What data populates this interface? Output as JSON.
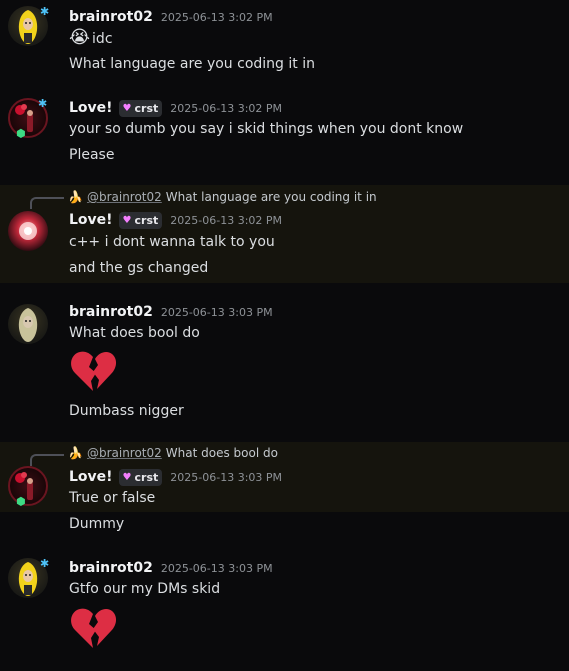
{
  "messages": [
    {
      "author": "brainrot02",
      "timestamp": "2025-06-13 3:02 PM",
      "lines": [
        "idc",
        "What language are you coding it in"
      ],
      "emoji": "😭"
    },
    {
      "author": "Love!",
      "tag": "crst",
      "timestamp": "2025-06-13 3:02 PM",
      "lines": [
        "your so dumb you say i skid things when you dont know",
        "Please"
      ]
    },
    {
      "reply": {
        "mention": "@brainrot02",
        "text": "What language are you coding it in"
      },
      "author": "Love!",
      "tag": "crst",
      "timestamp": "2025-06-13 3:02 PM",
      "lines": [
        "c++ i dont wanna talk to you",
        "and the gs changed"
      ]
    },
    {
      "author": "brainrot02",
      "timestamp": "2025-06-13 3:03 PM",
      "lines": [
        "What does bool do",
        "Dumbass nigger"
      ],
      "emoji_line": "💔"
    },
    {
      "reply": {
        "mention": "@brainrot02",
        "text": "What does bool do"
      },
      "author": "Love!",
      "tag": "crst",
      "timestamp": "2025-06-13 3:03 PM",
      "lines": [
        "True or false",
        "Dummy"
      ]
    },
    {
      "author": "brainrot02",
      "timestamp": "2025-06-13 3:03 PM",
      "lines": [
        "Gtfo our my DMs skid"
      ],
      "emoji_line": "💔"
    }
  ],
  "colors": {
    "background": "#0a0a0c",
    "highlight": "#15140d",
    "tag_heart": "#f47fff",
    "heart": "#dd2e44"
  },
  "icons": [
    "banana-avatar-icon",
    "rose-avatar-icon",
    "broken-heart-icon",
    "sob-emoji-icon",
    "heart-tag-icon"
  ]
}
